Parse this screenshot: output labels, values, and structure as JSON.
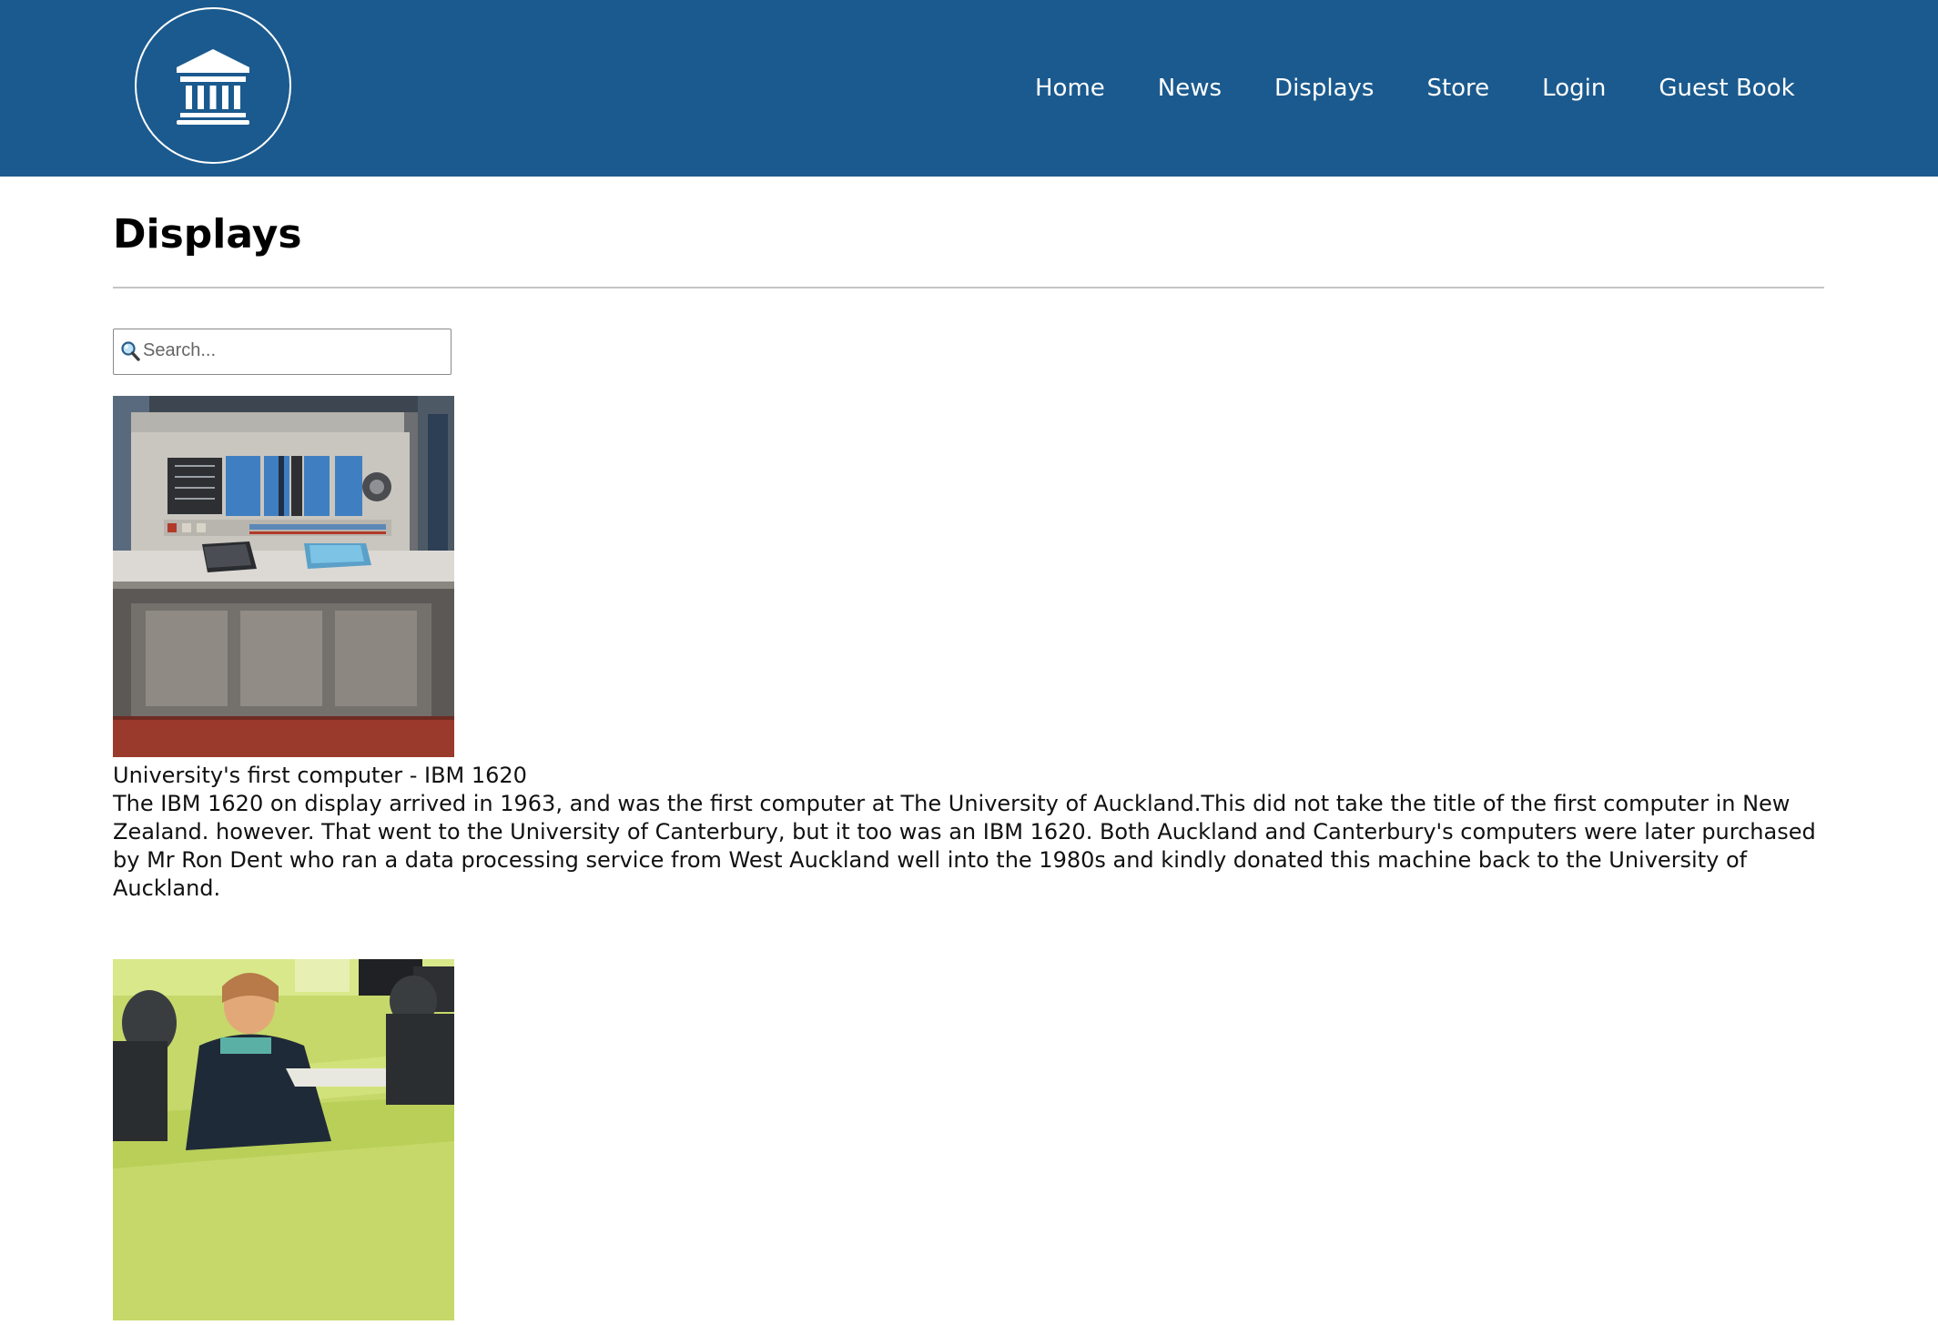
{
  "header": {
    "logo_icon": "museum-building-icon",
    "background_color": "#1b5a8e",
    "nav": [
      {
        "label": "Home"
      },
      {
        "label": "News"
      },
      {
        "label": "Displays"
      },
      {
        "label": "Store"
      },
      {
        "label": "Login"
      },
      {
        "label": "Guest Book"
      }
    ]
  },
  "main": {
    "title": "Displays",
    "search": {
      "placeholder": "Search...",
      "value": "",
      "icon": "magnifier-icon"
    },
    "displays": [
      {
        "title": "University's first computer - IBM 1620",
        "description": "The IBM 1620 on display arrived in 1963, and was the first computer at The University of Auckland.This did not take the title of the first computer in New Zealand. however. That went to the University of Canterbury, but it too was an IBM 1620. Both Auckland and Canterbury's computers were later purchased by Mr Ron Dent who ran a data processing service from West Auckland well into the 1980s and kindly donated this machine back to the University of Auckland.",
        "image": "ibm-1620-photo"
      },
      {
        "title": "",
        "description": "",
        "image": "classroom-photo"
      }
    ]
  }
}
